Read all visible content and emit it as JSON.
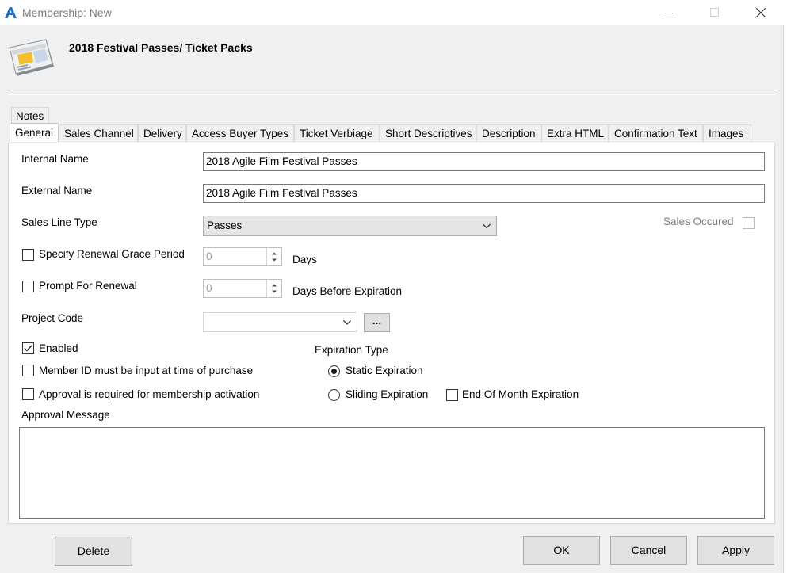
{
  "window": {
    "title": "Membership: New"
  },
  "header": {
    "title": "2018 Festival Passes/ Ticket Packs"
  },
  "tabs": {
    "notes": "Notes",
    "items": [
      "General",
      "Sales Channel",
      "Delivery",
      "Access Buyer Types",
      "Ticket Verbiage",
      "Short Descriptives",
      "Description",
      "Extra HTML",
      "Confirmation Text",
      "Images"
    ],
    "active": "General"
  },
  "form": {
    "internal_name_label": "Internal Name",
    "internal_name_value": "2018 Agile Film Festival Passes",
    "external_name_label": "External Name",
    "external_name_value": "2018 Agile Film Festival Passes",
    "sales_line_type_label": "Sales Line Type",
    "sales_line_type_value": "Passes",
    "sales_occured_label": "Sales Occured",
    "renewal_grace_label": "Specify Renewal Grace Period",
    "renewal_grace_value": "0",
    "renewal_grace_unit": "Days",
    "prompt_renewal_label": "Prompt For Renewal",
    "prompt_renewal_value": "0",
    "prompt_renewal_unit": "Days Before Expiration",
    "project_code_label": "Project Code",
    "project_code_browse": "...",
    "enabled_label": "Enabled",
    "enabled_checked": true,
    "member_id_label": "Member ID must be input at time of purchase",
    "approval_required_label": "Approval is required for membership activation",
    "expiration_type_label": "Expiration Type",
    "static_expiration_label": "Static Expiration",
    "sliding_expiration_label": "Sliding Expiration",
    "end_of_month_label": "End Of Month Expiration",
    "expiration_selected": "Static Expiration",
    "approval_message_label": "Approval Message",
    "approval_message_value": ""
  },
  "buttons": {
    "delete": "Delete",
    "ok": "OK",
    "cancel": "Cancel",
    "apply": "Apply"
  },
  "icons": {
    "logo": "app-logo-icon",
    "membership_card": "membership-card-icon",
    "minimize": "minimize-icon",
    "maximize": "maximize-icon",
    "close": "close-icon",
    "dropdown": "chevron-down-icon",
    "spin_up": "spin-up-icon",
    "spin_down": "spin-down-icon",
    "check": "check-icon"
  },
  "colors": {
    "logo": "#1f6fc5",
    "titlebar": "#ffffff",
    "window_bg": "#f0f0f0",
    "panel_bg": "#ffffff"
  }
}
